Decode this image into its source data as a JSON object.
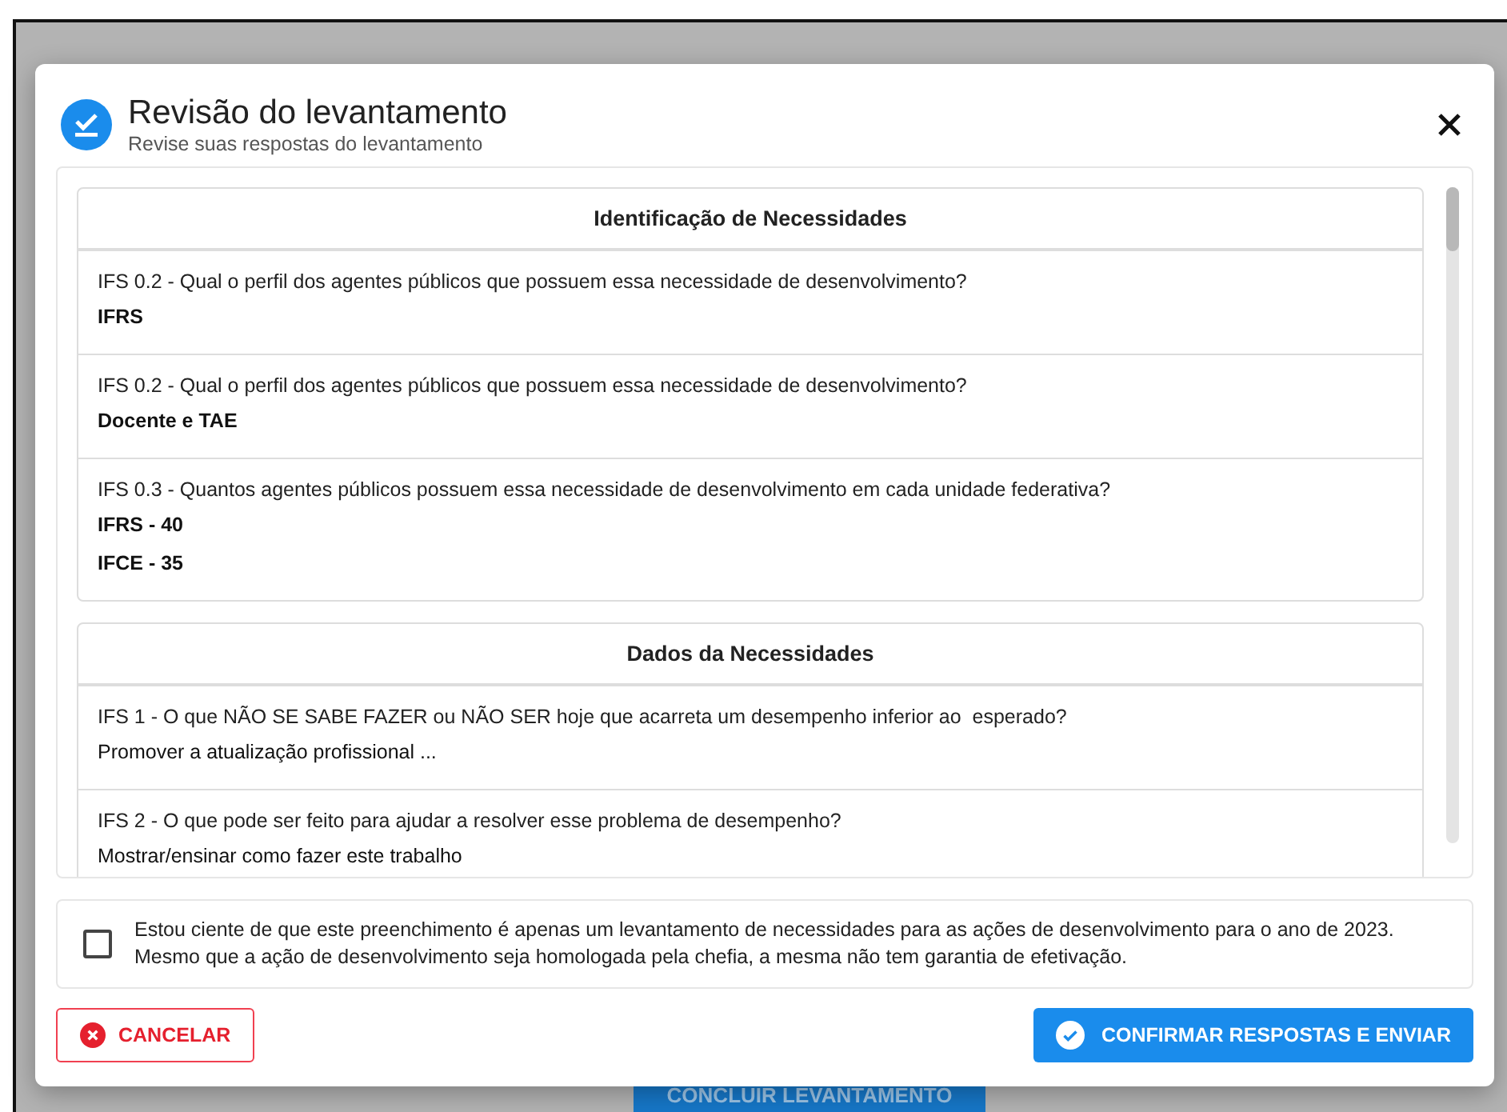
{
  "background": {
    "button": "CONCLUIR LEVANTAMENTO"
  },
  "dialog": {
    "title": "Revisão do levantamento",
    "subtitle": "Revise suas respostas do levantamento",
    "sections": [
      {
        "title": "Identificação de Necessidades",
        "items": [
          {
            "question": "IFS 0.2 - Qual o perfil dos agentes públicos que possuem essa necessidade de desenvolvimento?",
            "answers": [
              "IFRS"
            ],
            "bold": true
          },
          {
            "question": "IFS 0.2 - Qual o perfil dos agentes públicos que possuem essa necessidade de desenvolvimento?",
            "answers": [
              "Docente e TAE"
            ],
            "bold": true
          },
          {
            "question": "IFS 0.3 - Quantos agentes públicos possuem essa necessidade de desenvolvimento em cada unidade federativa?",
            "answers": [
              "IFRS - 40",
              "IFCE - 35"
            ],
            "bold": true
          }
        ]
      },
      {
        "title": "Dados da Necessidades",
        "items": [
          {
            "question": "IFS 1 - O que NÃO SE SABE FAZER ou NÃO SER hoje que acarreta um desempenho inferior ao  esperado?",
            "answers": [
              "Promover a atualização profissional ..."
            ],
            "bold": false
          },
          {
            "question": "IFS 2 - O que pode ser feito para ajudar a resolver esse problema de desempenho?",
            "answers": [
              "Mostrar/ensinar como fazer este trabalho"
            ],
            "bold": false
          }
        ]
      }
    ],
    "agreement": {
      "checked": false,
      "text": "Estou ciente de que este preenchimento é apenas um levantamento de necessidades para as ações de desenvolvimento para o ano de 2023. Mesmo que a ação de desenvolvimento seja homologada pela chefia, a mesma não tem garantia de efetivação."
    },
    "cancel": "CANCELAR",
    "confirm": "CONFIRMAR RESPOSTAS E ENVIAR"
  }
}
